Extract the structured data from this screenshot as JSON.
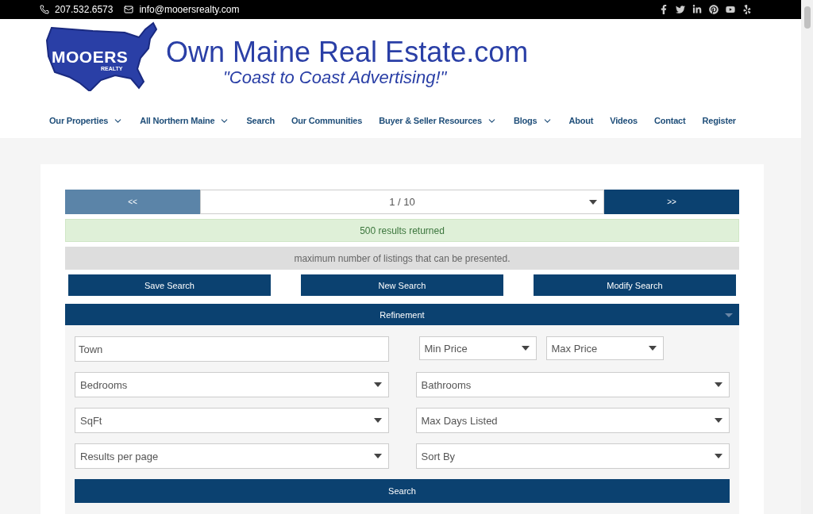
{
  "top_bar": {
    "phone": "207.532.6573",
    "email": "info@mooersrealty.com"
  },
  "logo": {
    "name": "MOOERS",
    "sub": "REALTY"
  },
  "site_title": "Own Maine Real Estate.com",
  "tagline": "\"Coast to Coast Advertising!\"",
  "nav": [
    {
      "label": "Our Properties",
      "has_menu": true
    },
    {
      "label": "All Northern Maine",
      "has_menu": true
    },
    {
      "label": "Search",
      "has_menu": false
    },
    {
      "label": "Our Communities",
      "has_menu": false
    },
    {
      "label": "Buyer & Seller Resources",
      "has_menu": true
    },
    {
      "label": "Blogs",
      "has_menu": true
    },
    {
      "label": "About",
      "has_menu": false
    },
    {
      "label": "Videos",
      "has_menu": false
    },
    {
      "label": "Contact",
      "has_menu": false
    },
    {
      "label": "Register",
      "has_menu": false
    }
  ],
  "pager": {
    "prev": {
      "label": "<<",
      "disabled": true
    },
    "page": "1 / 10",
    "next": {
      "label": ">>",
      "disabled": false
    }
  },
  "results": "500 results returned",
  "notice": "maximum number of listings that can be presented.",
  "actions": [
    "Save Search",
    "New Search",
    "Modify Search"
  ],
  "refinement": {
    "title": "Refinement",
    "rows": [
      [
        [
          {
            "kind": "text",
            "placeholder": "Town"
          }
        ],
        [
          {
            "kind": "small_select",
            "label": "Min Price"
          },
          {
            "kind": "small_select",
            "label": "Max Price"
          }
        ]
      ],
      [
        [
          {
            "kind": "select",
            "label": "Bedrooms"
          }
        ],
        [
          {
            "kind": "select",
            "label": "Bathrooms"
          }
        ]
      ],
      [
        [
          {
            "kind": "select",
            "label": "SqFt"
          }
        ],
        [
          {
            "kind": "select",
            "label": "Max Days Listed"
          }
        ]
      ],
      [
        [
          {
            "kind": "select",
            "label": "Results per page"
          }
        ],
        [
          {
            "kind": "select",
            "label": "Sort By"
          }
        ]
      ]
    ],
    "submit": "Search"
  }
}
